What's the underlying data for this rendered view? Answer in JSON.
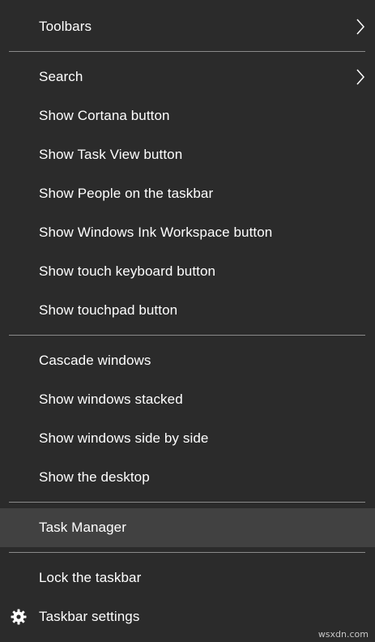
{
  "menu": {
    "toolbars": "Toolbars",
    "search": "Search",
    "show_cortana": "Show Cortana button",
    "show_task_view": "Show Task View button",
    "show_people": "Show People on the taskbar",
    "show_ink_workspace": "Show Windows Ink Workspace button",
    "show_touch_keyboard": "Show touch keyboard button",
    "show_touchpad": "Show touchpad button",
    "cascade_windows": "Cascade windows",
    "show_stacked": "Show windows stacked",
    "show_side_by_side": "Show windows side by side",
    "show_desktop": "Show the desktop",
    "task_manager": "Task Manager",
    "lock_taskbar": "Lock the taskbar",
    "taskbar_settings": "Taskbar settings"
  },
  "icons": {
    "submenu": "chevron-right-icon",
    "settings": "gear-icon"
  },
  "colors": {
    "background": "#2b2b2b",
    "highlight": "#414141",
    "separator": "#8a8a8a",
    "text": "#ffffff"
  },
  "watermark": "wsxdn.com"
}
